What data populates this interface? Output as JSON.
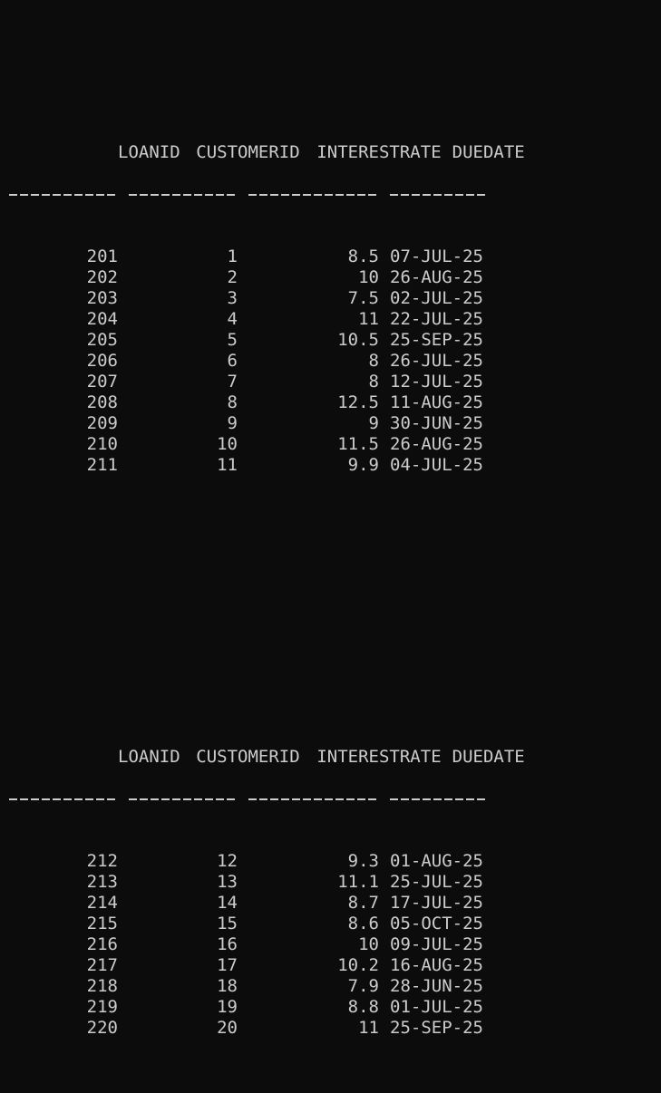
{
  "columns": [
    "LOANID",
    "CUSTOMERID",
    "INTERESTRATE",
    "DUEDATE"
  ],
  "separator_lengths": [
    10,
    10,
    12,
    9
  ],
  "pages": [
    {
      "rows": [
        [
          "201",
          "1",
          "8.5",
          "07-JUL-25"
        ],
        [
          "202",
          "2",
          "10",
          "26-AUG-25"
        ],
        [
          "203",
          "3",
          "7.5",
          "02-JUL-25"
        ],
        [
          "204",
          "4",
          "11",
          "22-JUL-25"
        ],
        [
          "205",
          "5",
          "10.5",
          "25-SEP-25"
        ],
        [
          "206",
          "6",
          "8",
          "26-JUL-25"
        ],
        [
          "207",
          "7",
          "8",
          "12-JUL-25"
        ],
        [
          "208",
          "8",
          "12.5",
          "11-AUG-25"
        ],
        [
          "209",
          "9",
          "9",
          "30-JUN-25"
        ],
        [
          "210",
          "10",
          "11.5",
          "26-AUG-25"
        ],
        [
          "211",
          "11",
          "9.9",
          "04-JUL-25"
        ]
      ]
    },
    {
      "rows": [
        [
          "212",
          "12",
          "9.3",
          "01-AUG-25"
        ],
        [
          "213",
          "13",
          "11.1",
          "25-JUL-25"
        ],
        [
          "214",
          "14",
          "8.7",
          "17-JUL-25"
        ],
        [
          "215",
          "15",
          "8.6",
          "05-OCT-25"
        ],
        [
          "216",
          "16",
          "10",
          "09-JUL-25"
        ],
        [
          "217",
          "17",
          "10.2",
          "16-AUG-25"
        ],
        [
          "218",
          "18",
          "7.9",
          "28-JUN-25"
        ],
        [
          "219",
          "19",
          "8.8",
          "01-JUL-25"
        ],
        [
          "220",
          "20",
          "11",
          "25-SEP-25"
        ]
      ]
    }
  ]
}
